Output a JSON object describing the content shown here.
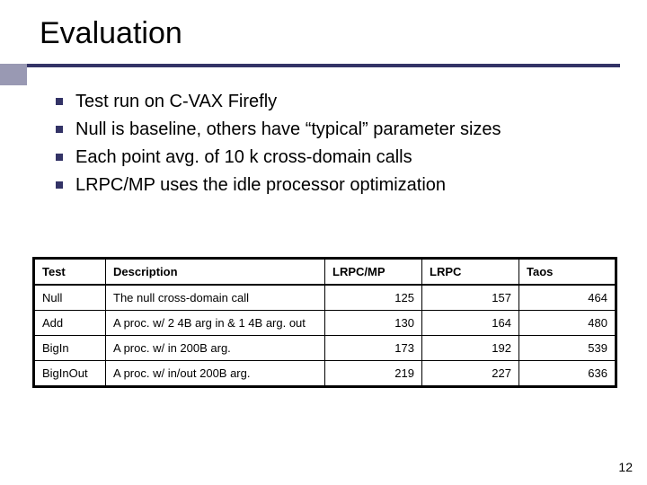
{
  "title": "Evaluation",
  "bullets": [
    "Test run on C-VAX Firefly",
    "Null is baseline, others have “typical” parameter sizes",
    "Each point avg. of 10 k cross-domain calls",
    "LRPC/MP uses the idle processor optimization"
  ],
  "table": {
    "headers": [
      "Test",
      "Description",
      "LRPC/MP",
      "LRPC",
      "Taos"
    ],
    "rows": [
      {
        "test": "Null",
        "desc": "The null cross-domain call",
        "v1": 125,
        "v2": 157,
        "v3": 464
      },
      {
        "test": "Add",
        "desc": "A proc. w/ 2 4B arg in & 1 4B arg. out",
        "v1": 130,
        "v2": 164,
        "v3": 480
      },
      {
        "test": "BigIn",
        "desc": "A proc. w/ in 200B arg.",
        "v1": 173,
        "v2": 192,
        "v3": 539
      },
      {
        "test": "BigInOut",
        "desc": "A proc. w/ in/out 200B arg.",
        "v1": 219,
        "v2": 227,
        "v3": 636
      }
    ]
  },
  "page_number": "12",
  "chart_data": {
    "type": "table",
    "title": "Evaluation",
    "columns": [
      "Test",
      "Description",
      "LRPC/MP",
      "LRPC",
      "Taos"
    ],
    "rows": [
      [
        "Null",
        "The null cross-domain call",
        125,
        157,
        464
      ],
      [
        "Add",
        "A proc. w/ 2 4B arg in & 1 4B arg. out",
        130,
        164,
        480
      ],
      [
        "BigIn",
        "A proc. w/ in 200B arg.",
        173,
        192,
        539
      ],
      [
        "BigInOut",
        "A proc. w/ in/out 200B arg.",
        219,
        227,
        636
      ]
    ]
  }
}
